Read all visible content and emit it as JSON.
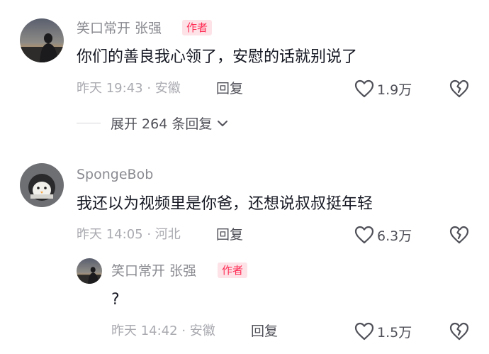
{
  "comments": [
    {
      "username": "笑口常开 张强",
      "badge": "作者",
      "text": "你们的善良我心领了，安慰的话就别说了",
      "time_location": "昨天 19:43 · 安徽",
      "reply_label": "回复",
      "likes": "1.9万",
      "expand_label": "展开 264 条回复"
    },
    {
      "username": "SpongeBob",
      "text": "我还以为视频里是你爸，还想说叔叔挺年轻",
      "time_location": "昨天 14:05 · 河北",
      "reply_label": "回复",
      "likes": "6.3万",
      "replies": [
        {
          "username": "笑口常开 张强",
          "badge": "作者",
          "text": "?",
          "time_location": "昨天 14:42 · 安徽",
          "reply_label": "回复",
          "likes": "1.5万"
        }
      ]
    }
  ],
  "colors": {
    "badge_text": "#fe2c55",
    "badge_bg": "#fde3e8",
    "meta_gray": "#a9aab0",
    "username_gray": "#8a8b91",
    "text_dark": "#161823"
  },
  "icons": [
    "heart-outline-icon",
    "broken-heart-icon",
    "chevron-down-icon"
  ]
}
